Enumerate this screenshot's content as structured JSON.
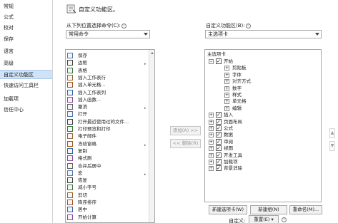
{
  "nav": {
    "items": [
      {
        "label": "常规",
        "active": false
      },
      {
        "label": "公式",
        "active": false
      },
      {
        "label": "校对",
        "active": false
      },
      {
        "label": "保存",
        "active": false
      },
      {
        "label": "语言",
        "active": false
      },
      {
        "label": "高级",
        "active": false
      },
      {
        "label": "自定义功能区",
        "active": true
      },
      {
        "label": "快速访问工具栏",
        "active": false
      },
      {
        "label": "加载项",
        "active": false
      },
      {
        "label": "信任中心",
        "active": false
      }
    ]
  },
  "header": {
    "title": "自定义功能区。"
  },
  "left_panel": {
    "label": "从下列位置选择命令(C):",
    "dropdown_value": "常用命令",
    "commands": [
      {
        "label": "保存",
        "icon": "save-icon"
      },
      {
        "label": "边框",
        "icon": "border-icon"
      },
      {
        "label": "表格",
        "icon": "table-icon"
      },
      {
        "label": "插入工作表行",
        "icon": "insert-row-icon"
      },
      {
        "label": "插入单元格...",
        "icon": "insert-cell-icon"
      },
      {
        "label": "插入工作表列",
        "icon": "insert-column-icon"
      },
      {
        "label": "插入函数...",
        "icon": "function-icon"
      },
      {
        "label": "撤消",
        "icon": "undo-icon"
      },
      {
        "label": "打开",
        "icon": "open-icon"
      },
      {
        "label": "打开最近使用过的文件...",
        "icon": "recent-file-icon"
      },
      {
        "label": "打印预览和打印",
        "icon": "print-preview-icon"
      },
      {
        "label": "电子邮件",
        "icon": "email-icon"
      },
      {
        "label": "冻结窗格",
        "icon": "freeze-panes-icon"
      },
      {
        "label": "复制",
        "icon": "copy-icon"
      },
      {
        "label": "格式刷",
        "icon": "format-painter-icon"
      },
      {
        "label": "合并后居中",
        "icon": "merge-center-icon"
      },
      {
        "label": "宏",
        "icon": "macro-icon"
      },
      {
        "label": "恢复",
        "icon": "redo-icon"
      },
      {
        "label": "减小字号",
        "icon": "decrease-font-icon"
      },
      {
        "label": "剪切",
        "icon": "cut-icon"
      },
      {
        "label": "降序排序",
        "icon": "sort-desc-icon"
      },
      {
        "label": "居中",
        "icon": "center-icon"
      },
      {
        "label": "开始计算",
        "icon": "calculate-icon"
      }
    ]
  },
  "middle": {
    "add_label": "添加(A) >>",
    "remove_label": "<< 删除(R)"
  },
  "right_panel": {
    "label": "自定义功能区(B):",
    "dropdown_value": "主选项卡",
    "tree_root": "主选项卡",
    "tabs": [
      {
        "label": "开始",
        "expanded": true,
        "checked": true,
        "groups": [
          "剪贴板",
          "字体",
          "对齐方式",
          "数字",
          "样式",
          "单元格",
          "编辑"
        ]
      },
      {
        "label": "插入",
        "expanded": false,
        "checked": true
      },
      {
        "label": "页面布局",
        "expanded": false,
        "checked": true
      },
      {
        "label": "公式",
        "expanded": false,
        "checked": true
      },
      {
        "label": "数据",
        "expanded": false,
        "checked": true
      },
      {
        "label": "审阅",
        "expanded": false,
        "checked": true
      },
      {
        "label": "视图",
        "expanded": false,
        "checked": true
      },
      {
        "label": "开发工具",
        "expanded": false,
        "checked": true
      },
      {
        "label": "加载项",
        "expanded": false,
        "checked": true
      },
      {
        "label": "背景消除",
        "expanded": false,
        "checked": true
      }
    ],
    "new_tab_label": "新建选项卡(W)",
    "new_group_label": "新建组(N)",
    "rename_label": "重命名(M)...",
    "customize_label": "自定义:",
    "reset_label": "重置(E) ▾"
  },
  "colors": {
    "nav_active": "#cfe2f7",
    "border": "#a8a8a8"
  }
}
